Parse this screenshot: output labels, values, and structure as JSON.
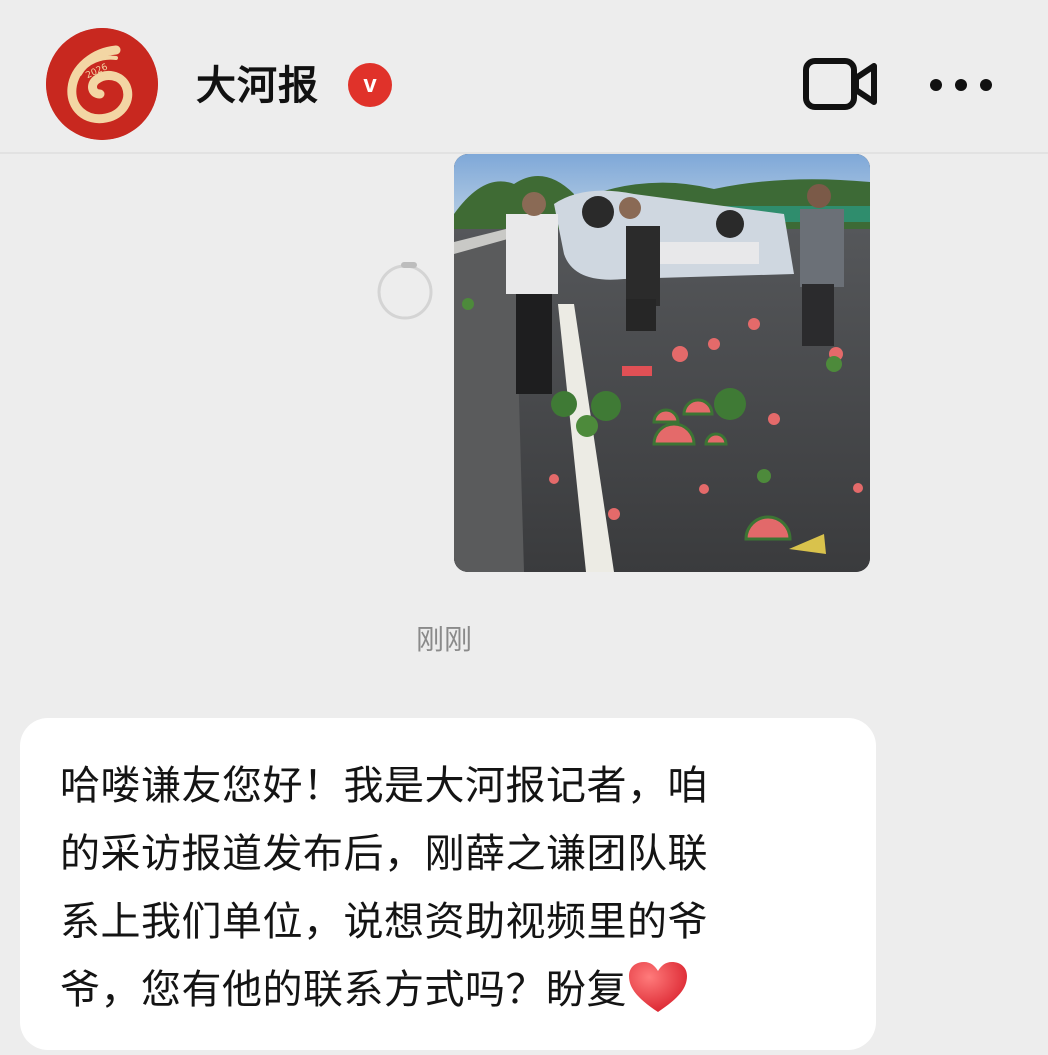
{
  "header": {
    "account_name": "大河报",
    "verified_badge": "v",
    "avatar_text": "2026",
    "video_icon": "video-camera-icon",
    "more_icon": "more-dots-icon"
  },
  "chat": {
    "image_message": "watermelon-accident-photo",
    "timestamp": "刚刚",
    "message_lines": [
      "哈喽谦友您好！我是大河报记者，咱",
      "的采访报道发布后，刚薛之谦团队联",
      "系上我们单位，说想资助视频里的爷",
      "爷，您有他的联系方式吗？盼复"
    ],
    "message_emoji": "red-heart-icon"
  },
  "colors": {
    "background": "#ededed",
    "bubble": "#ffffff",
    "brand_red": "#c8281f",
    "badge_red": "#e0322a"
  }
}
